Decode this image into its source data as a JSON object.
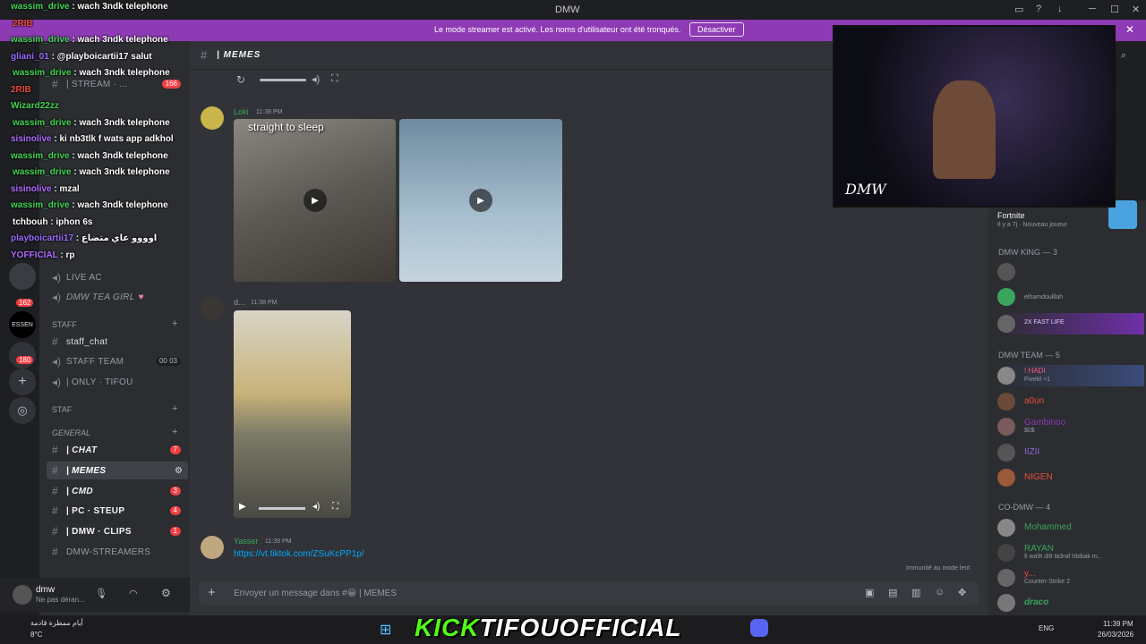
{
  "window": {
    "title": "DMW"
  },
  "banner": {
    "message": "Le mode streamer est activé. Les noms d'utilisateur ont été tronqués.",
    "button": "Désactiver"
  },
  "channel": {
    "name": "| MEMES",
    "composer_placeholder": "Envoyer un message dans #😀 | MEMES",
    "immunity": "Immunité au mode lent"
  },
  "sidebar": {
    "cat_staff": "STAFF",
    "cat_staf": "STAF",
    "cat_general": "GENERAL",
    "items": [
      {
        "name": "| STREAM · ...",
        "badge": "166"
      },
      {
        "name": "LIVE AC",
        "badge": ""
      },
      {
        "name": "DMW TEA GIRL",
        "badge": ""
      },
      {
        "name": "staff_chat",
        "badge": ""
      },
      {
        "name": "STAFF TEAM",
        "badge": "00 03"
      },
      {
        "name": "| ONLY · TIFOU",
        "badge": ""
      },
      {
        "name": "| CHAT",
        "badge": "7"
      },
      {
        "name": "| MEMES",
        "badge": ""
      },
      {
        "name": "| CMD",
        "badge": "3"
      },
      {
        "name": "| PC · STEUP",
        "badge": "4"
      },
      {
        "name": "| DMW · CLIPS",
        "badge": "1"
      },
      {
        "name": "DMW-STREAMERS",
        "badge": ""
      }
    ],
    "server_badges": [
      "162",
      "180"
    ],
    "server_label": "ESSEN"
  },
  "user": {
    "name": "dmw",
    "status": "Ne pas déran..."
  },
  "chat_overlay": [
    {
      "user": "wassim_drive",
      "text": "wach 3ndk telephone",
      "color": "#43d655"
    },
    {
      "user": "2RIB",
      "text": "",
      "color": "#e74c3c"
    },
    {
      "user": "wassim_drive",
      "text": "wach 3ndk telephone",
      "color": "#43d655"
    },
    {
      "user": "gliani_01",
      "text": "@playboicartii17 salut",
      "color": "#9b6bff"
    },
    {
      "user": "wassim_drive",
      "text": "wach 3ndk telephone",
      "color": "#43d655"
    },
    {
      "user": "2RIB",
      "text": "",
      "color": "#e74c3c"
    },
    {
      "user": "Wizard22zz",
      "text": "",
      "color": "#43d655"
    },
    {
      "user": "wassim_drive",
      "text": "wach 3ndk telephone",
      "color": "#43d655"
    },
    {
      "user": "sisinolive",
      "text": "ki nb3tlk f wats app adkhol",
      "color": "#b36bff"
    },
    {
      "user": "wassim_drive",
      "text": "wach 3ndk telephone",
      "color": "#43d655"
    },
    {
      "user": "wassim_drive",
      "text": "wach 3ndk telephone",
      "color": "#43d655"
    },
    {
      "user": "sisinolive",
      "text": "mzal",
      "color": "#b36bff"
    },
    {
      "user": "wassim_drive",
      "text": "wach 3ndk telephone",
      "color": "#43d655"
    },
    {
      "user": "tchbouh",
      "text": "iphon 6s",
      "color": "#ffffff"
    },
    {
      "user": "playboicartii17",
      "text": "اوووو عاي متضاع",
      "color": "#9b6bff"
    },
    {
      "user": "YOFFICIAL",
      "text": "rp",
      "color": "#b36bff"
    }
  ],
  "messages": [
    {
      "author": "Loki",
      "time": "11:38 PM",
      "caption": "straight to sleep"
    },
    {
      "author": "d...",
      "time": "11:38 PM"
    },
    {
      "author": "Yasser",
      "time": "11:39 PM",
      "link": "https://vt.tiktok.com/ZSuKcPP1p/"
    }
  ],
  "members": {
    "activity": {
      "game": "Fortnite",
      "detail": "Il y a 7j · Nouveau joueur"
    },
    "groups": [
      {
        "title": "DMW KING — 3",
        "list": [
          {
            "name": "",
            "status": ""
          },
          {
            "name": "",
            "status": "elhamdoulilah"
          },
          {
            "name": "2X FAST LIFE",
            "status": ""
          }
        ]
      },
      {
        "title": "DMW TEAM — 5",
        "list": [
          {
            "name": "! HADI",
            "status": "FiveM +1"
          },
          {
            "name": "a0un",
            "status": ""
          },
          {
            "name": "Gambinoo",
            "status": "$0$"
          },
          {
            "name": "IIZII",
            "status": ""
          },
          {
            "name": "NIGEN",
            "status": ""
          }
        ]
      },
      {
        "title": "CO-DMW — 4",
        "list": [
          {
            "name": "Mohammed",
            "status": ""
          },
          {
            "name": "RAYAN",
            "status": "fi wa9t di9 ta3raf hbibak m..."
          },
          {
            "name": "y...",
            "status": "Counter-Strike 2"
          },
          {
            "name": "draco",
            "status": ""
          }
        ]
      }
    ]
  },
  "cam": {
    "label": "DMW"
  },
  "kick": {
    "brand": "KICK",
    "channel": "TIFOUOFFICIAL"
  },
  "taskbar": {
    "weather": "أيام ممطرة قادمة",
    "temp": "8°C",
    "lang": "ENG",
    "time": "11:39 PM",
    "date": "26/03/2026"
  }
}
